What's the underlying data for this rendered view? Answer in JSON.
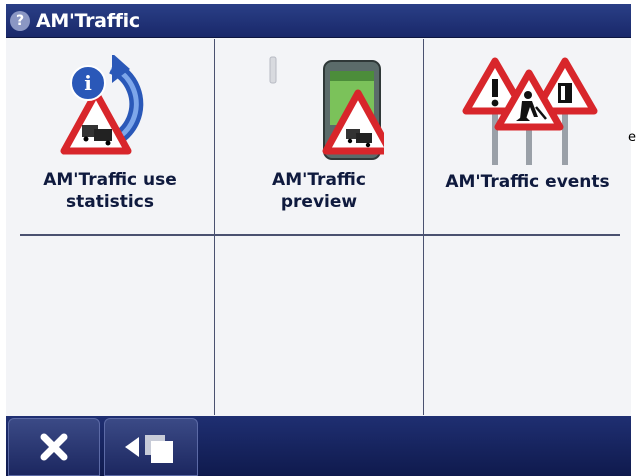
{
  "window": {
    "title": "AM'Traffic",
    "help_icon": "?"
  },
  "menu": {
    "items": [
      {
        "label_line1": "AM'Traffic use",
        "label_line2": "statistics",
        "icon": "statistics-icon"
      },
      {
        "label_line1": "AM'Traffic",
        "label_line2": "preview",
        "icon": "preview-device-icon"
      },
      {
        "label_line1": "AM'Traffic events",
        "label_line2": "",
        "icon": "road-signs-icon"
      }
    ]
  },
  "toolbar": {
    "close_icon": "close-icon",
    "back_icon": "back-icon"
  },
  "edge_text": "e",
  "colors": {
    "titlebar": "#1f2f72",
    "warning_red": "#d8262b",
    "info_blue": "#2a58b8"
  }
}
